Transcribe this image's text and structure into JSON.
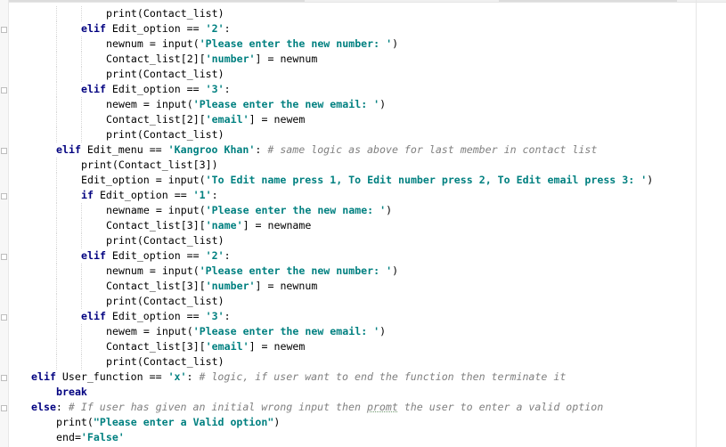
{
  "theme": {
    "keyword": "#000080",
    "string": "#008080",
    "comment": "#808080",
    "text": "#000000",
    "background": "#ffffff"
  },
  "lines": [
    {
      "indent": 12,
      "tokens": [
        {
          "t": "t",
          "v": "print(Contact_list)"
        }
      ]
    },
    {
      "indent": 8,
      "tokens": [
        {
          "t": "k",
          "v": "elif"
        },
        {
          "t": "t",
          "v": " Edit_option == "
        },
        {
          "t": "s",
          "v": "'2'"
        },
        {
          "t": "t",
          "v": ":"
        }
      ]
    },
    {
      "indent": 12,
      "tokens": [
        {
          "t": "t",
          "v": "newnum = input("
        },
        {
          "t": "s",
          "v": "'Please enter the new number: '"
        },
        {
          "t": "t",
          "v": ")"
        }
      ]
    },
    {
      "indent": 12,
      "tokens": [
        {
          "t": "t",
          "v": "Contact_list[2]["
        },
        {
          "t": "s",
          "v": "'number'"
        },
        {
          "t": "t",
          "v": "] = newnum"
        }
      ]
    },
    {
      "indent": 12,
      "tokens": [
        {
          "t": "t",
          "v": "print(Contact_list)"
        }
      ]
    },
    {
      "indent": 8,
      "tokens": [
        {
          "t": "k",
          "v": "elif"
        },
        {
          "t": "t",
          "v": " Edit_option == "
        },
        {
          "t": "s",
          "v": "'3'"
        },
        {
          "t": "t",
          "v": ":"
        }
      ]
    },
    {
      "indent": 12,
      "tokens": [
        {
          "t": "t",
          "v": "newem = input("
        },
        {
          "t": "s",
          "v": "'Please enter the new email: '"
        },
        {
          "t": "t",
          "v": ")"
        }
      ]
    },
    {
      "indent": 12,
      "tokens": [
        {
          "t": "t",
          "v": "Contact_list[2]["
        },
        {
          "t": "s",
          "v": "'email'"
        },
        {
          "t": "t",
          "v": "] = newem"
        }
      ]
    },
    {
      "indent": 12,
      "tokens": [
        {
          "t": "t",
          "v": "print(Contact_list)"
        }
      ]
    },
    {
      "indent": 4,
      "tokens": [
        {
          "t": "k",
          "v": "elif"
        },
        {
          "t": "t",
          "v": " Edit_menu == "
        },
        {
          "t": "s",
          "v": "'Kangroo Khan'"
        },
        {
          "t": "t",
          "v": ": "
        },
        {
          "t": "c",
          "v": "# same logic as above for last member in contact list"
        }
      ]
    },
    {
      "indent": 8,
      "tokens": [
        {
          "t": "t",
          "v": "print(Contact_list[3])"
        }
      ]
    },
    {
      "indent": 8,
      "tokens": [
        {
          "t": "t",
          "v": "Edit_option = input("
        },
        {
          "t": "s",
          "v": "'To Edit name press 1, To Edit number press 2, To Edit email press 3: '"
        },
        {
          "t": "t",
          "v": ")"
        }
      ]
    },
    {
      "indent": 8,
      "tokens": [
        {
          "t": "k",
          "v": "if"
        },
        {
          "t": "t",
          "v": " Edit_option == "
        },
        {
          "t": "s",
          "v": "'1'"
        },
        {
          "t": "t",
          "v": ":"
        }
      ]
    },
    {
      "indent": 12,
      "tokens": [
        {
          "t": "t",
          "v": "newname = input("
        },
        {
          "t": "s",
          "v": "'Please enter the new name: '"
        },
        {
          "t": "t",
          "v": ")"
        }
      ]
    },
    {
      "indent": 12,
      "tokens": [
        {
          "t": "t",
          "v": "Contact_list[3]["
        },
        {
          "t": "s",
          "v": "'name'"
        },
        {
          "t": "t",
          "v": "] = newname"
        }
      ]
    },
    {
      "indent": 12,
      "tokens": [
        {
          "t": "t",
          "v": "print(Contact_list)"
        }
      ]
    },
    {
      "indent": 8,
      "tokens": [
        {
          "t": "k",
          "v": "elif"
        },
        {
          "t": "t",
          "v": " Edit_option == "
        },
        {
          "t": "s",
          "v": "'2'"
        },
        {
          "t": "t",
          "v": ":"
        }
      ]
    },
    {
      "indent": 12,
      "tokens": [
        {
          "t": "t",
          "v": "newnum = input("
        },
        {
          "t": "s",
          "v": "'Please enter the new number: '"
        },
        {
          "t": "t",
          "v": ")"
        }
      ]
    },
    {
      "indent": 12,
      "tokens": [
        {
          "t": "t",
          "v": "Contact_list[3]["
        },
        {
          "t": "s",
          "v": "'number'"
        },
        {
          "t": "t",
          "v": "] = newnum"
        }
      ]
    },
    {
      "indent": 12,
      "tokens": [
        {
          "t": "t",
          "v": "print(Contact_list)"
        }
      ]
    },
    {
      "indent": 8,
      "tokens": [
        {
          "t": "k",
          "v": "elif"
        },
        {
          "t": "t",
          "v": " Edit_option == "
        },
        {
          "t": "s",
          "v": "'3'"
        },
        {
          "t": "t",
          "v": ":"
        }
      ]
    },
    {
      "indent": 12,
      "tokens": [
        {
          "t": "t",
          "v": "newem = input("
        },
        {
          "t": "s",
          "v": "'Please enter the new email: '"
        },
        {
          "t": "t",
          "v": ")"
        }
      ]
    },
    {
      "indent": 12,
      "tokens": [
        {
          "t": "t",
          "v": "Contact_list[3]["
        },
        {
          "t": "s",
          "v": "'email'"
        },
        {
          "t": "t",
          "v": "] = newem"
        }
      ]
    },
    {
      "indent": 12,
      "tokens": [
        {
          "t": "t",
          "v": "print(Contact_list)"
        }
      ]
    },
    {
      "indent": 0,
      "tokens": [
        {
          "t": "k",
          "v": "elif"
        },
        {
          "t": "t",
          "v": " User_function == "
        },
        {
          "t": "s",
          "v": "'x'"
        },
        {
          "t": "t",
          "v": ": "
        },
        {
          "t": "c",
          "v": "# logic, if user want to end the function then terminate it"
        }
      ]
    },
    {
      "indent": 4,
      "tokens": [
        {
          "t": "k",
          "v": "break"
        }
      ]
    },
    {
      "indent": 0,
      "tokens": [
        {
          "t": "k",
          "v": "else"
        },
        {
          "t": "t",
          "v": ": "
        },
        {
          "t": "c",
          "v": "# If user has given an initial wrong input then "
        },
        {
          "t": "cs",
          "v": "promt"
        },
        {
          "t": "c",
          "v": " the user to enter a valid option"
        }
      ]
    },
    {
      "indent": 4,
      "tokens": [
        {
          "t": "t",
          "v": "print("
        },
        {
          "t": "s",
          "v": "\"Please enter a Valid option\""
        },
        {
          "t": "t",
          "v": ")"
        }
      ]
    },
    {
      "indent": 4,
      "tokens": [
        {
          "t": "t",
          "v": "end="
        },
        {
          "t": "s",
          "v": "'False'"
        }
      ]
    }
  ]
}
